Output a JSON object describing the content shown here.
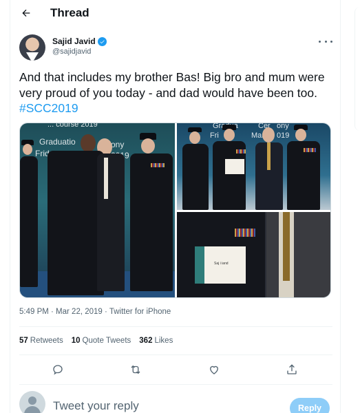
{
  "header": {
    "title": "Thread",
    "back_icon": "arrow-left-icon"
  },
  "tweet": {
    "author": {
      "name": "Sajid Javid",
      "handle": "@sajidjavid",
      "verified": true,
      "verified_icon": "verified-badge-icon"
    },
    "more_icon": "more-horizontal-icon",
    "text_main": "And that includes my brother Bas! Big bro and mum were very proud of you today - and dad would have been too.",
    "hashtag": "#SCC2019",
    "media": {
      "photo1": {
        "slide_line1": "Graduatio",
        "slide_line2": "Friday",
        "slide_line2b": "ony",
        "slide_line3": "2019",
        "slide_top": "... course 2019"
      },
      "photo2": {
        "slide_line1": "Gradua",
        "slide_line1b": "Cer",
        "slide_line1c": "ony",
        "slide_line2": "Fri",
        "slide_line2b": "Marc",
        "slide_line2c": "019"
      },
      "photo3": {
        "cert_text": "Saj i iand"
      }
    },
    "timestamp": "5:49 PM · Mar 22, 2019 · Twitter for iPhone",
    "stats": {
      "retweets_count": "57",
      "retweets_label": "Retweets",
      "quotes_count": "10",
      "quotes_label": "Quote Tweets",
      "likes_count": "362",
      "likes_label": "Likes"
    },
    "actions": [
      "reply-icon",
      "retweet-icon",
      "like-icon",
      "share-icon"
    ]
  },
  "reply": {
    "placeholder": "Tweet your reply",
    "button_label": "Reply"
  },
  "colors": {
    "accent": "#1d9bf0",
    "reply_button": "#8ecdf8",
    "muted_text": "#536471",
    "divider": "#eff3f4"
  }
}
